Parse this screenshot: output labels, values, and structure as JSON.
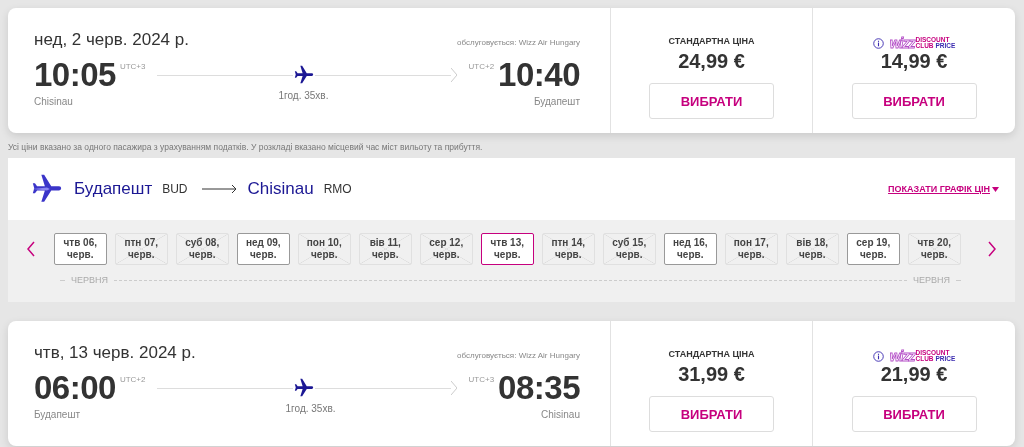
{
  "outbound": {
    "date": "нед, 2 черв. 2024 р.",
    "operator": "обслуговується: Wizz Air Hungary",
    "departure": {
      "time": "10:05",
      "utc": "UTC+3",
      "city": "Chisinau"
    },
    "arrival": {
      "time": "10:40",
      "utc": "UTC+2",
      "city": "Будапешт"
    },
    "duration": "1год. 35хв.",
    "fares": [
      {
        "kind": "standard",
        "label": "СТАНДАРТНА ЦІНА",
        "price": "24,99 €",
        "button": "ВИБРАТИ"
      },
      {
        "kind": "club",
        "logo": {
          "wordmark": "wizz",
          "line_1": "DISCOUNT",
          "line_2": "CLUB",
          "line_3": "PRICE"
        },
        "price": "14,99 €",
        "button": "ВИБРАТИ"
      }
    ]
  },
  "note": "Усі ціни вказано за одного пасажира з урахуванням податків. У розкладі вказано місцевий час міст вильоту та прибуття.",
  "return_route": {
    "from_city": "Будапешт",
    "from_code": "BUD",
    "to_city": "Chisinau",
    "to_code": "RMO",
    "chart_link": "ПОКАЗАТИ ГРАФІК ЦІН",
    "dates": [
      {
        "day": "чтв 06,",
        "month": "черв.",
        "available": true,
        "selected": false
      },
      {
        "day": "птн 07,",
        "month": "черв.",
        "available": false,
        "selected": false
      },
      {
        "day": "суб 08,",
        "month": "черв.",
        "available": false,
        "selected": false
      },
      {
        "day": "нед 09,",
        "month": "черв.",
        "available": true,
        "selected": false
      },
      {
        "day": "пон 10,",
        "month": "черв.",
        "available": false,
        "selected": false
      },
      {
        "day": "вів 11,",
        "month": "черв.",
        "available": false,
        "selected": false
      },
      {
        "day": "сер 12,",
        "month": "черв.",
        "available": false,
        "selected": false
      },
      {
        "day": "чтв 13,",
        "month": "черв.",
        "available": true,
        "selected": true
      },
      {
        "day": "птн 14,",
        "month": "черв.",
        "available": false,
        "selected": false
      },
      {
        "day": "суб 15,",
        "month": "черв.",
        "available": false,
        "selected": false
      },
      {
        "day": "нед 16,",
        "month": "черв.",
        "available": true,
        "selected": false
      },
      {
        "day": "пон 17,",
        "month": "черв.",
        "available": false,
        "selected": false
      },
      {
        "day": "вів 18,",
        "month": "черв.",
        "available": false,
        "selected": false
      },
      {
        "day": "сер 19,",
        "month": "черв.",
        "available": true,
        "selected": false
      },
      {
        "day": "чтв 20,",
        "month": "черв.",
        "available": false,
        "selected": false
      }
    ],
    "month_left": "ЧЕРВНЯ",
    "month_right": "ЧЕРВНЯ"
  },
  "return": {
    "date": "чтв, 13 черв. 2024 р.",
    "operator": "обслуговується: Wizz Air Hungary",
    "departure": {
      "time": "06:00",
      "utc": "UTC+2",
      "city": "Будапешт"
    },
    "arrival": {
      "time": "08:35",
      "utc": "UTC+3",
      "city": "Chisinau"
    },
    "duration": "1год. 35хв.",
    "fares": [
      {
        "kind": "standard",
        "label": "СТАНДАРТНА ЦІНА",
        "price": "31,99 €",
        "button": "ВИБРАТИ"
      },
      {
        "kind": "club",
        "logo": {
          "wordmark": "wizz",
          "line_1": "DISCOUNT",
          "line_2": "CLUB",
          "line_3": "PRICE"
        },
        "price": "21,99 €",
        "button": "ВИБРАТИ"
      }
    ]
  }
}
